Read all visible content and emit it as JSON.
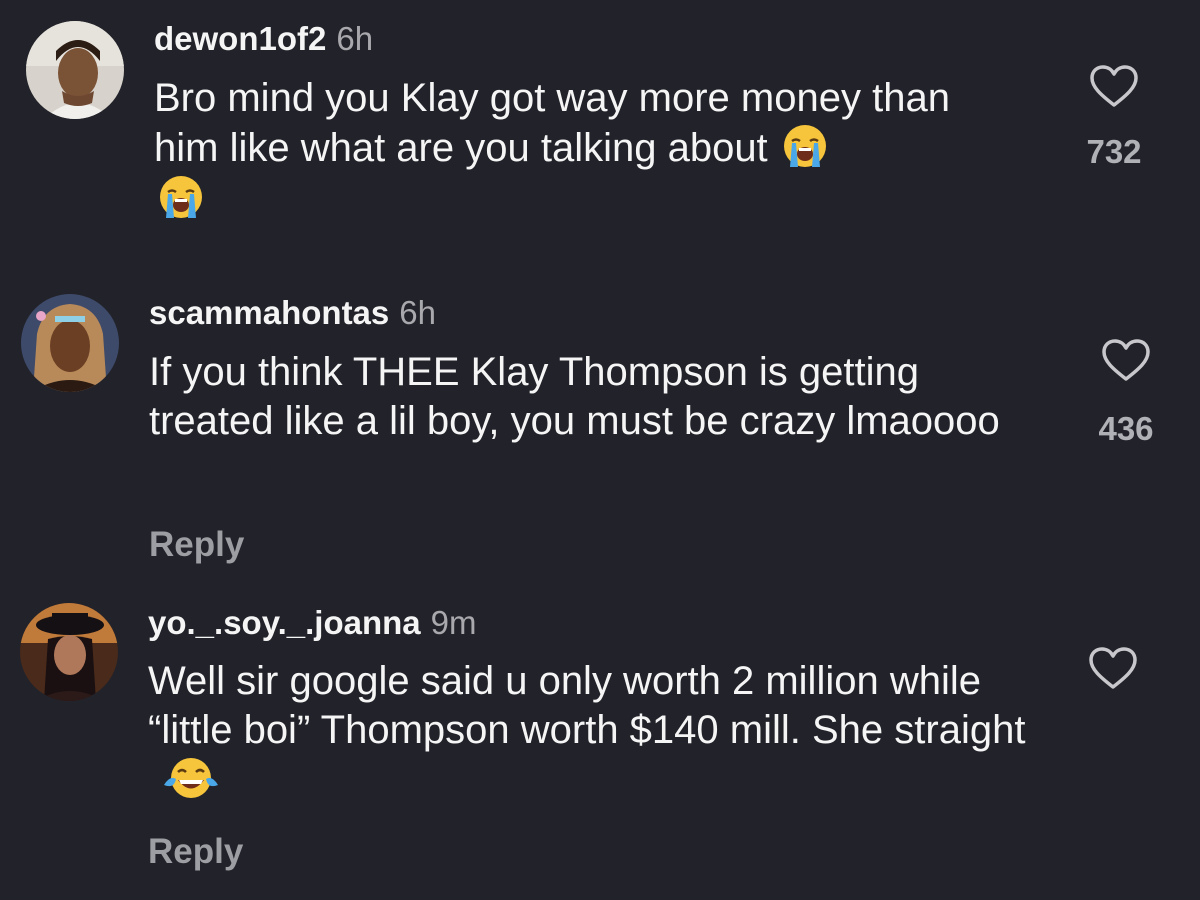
{
  "comments": [
    {
      "username": "dewon1of2",
      "time": "6h",
      "text": "Bro mind you Klay got way more money than him like what are you talking about",
      "emojis": [
        "loudly-crying-face",
        "loudly-crying-face"
      ],
      "likes": "732"
    },
    {
      "username": "scammahontas",
      "time": "6h",
      "text": "If you think THEE Klay Thompson is getting treated like a lil boy, you must be crazy lmaoooo",
      "likes": "436",
      "reply_label": "Reply"
    },
    {
      "username": "yo._.soy._.joanna",
      "time": "9m",
      "text": "Well sir google said u only worth 2 million while “little boi” Thompson worth $140 mill. She straight",
      "emojis": [
        "face-with-tears-of-joy"
      ],
      "reply_label": "Reply"
    }
  ],
  "colors": {
    "background": "#22232a",
    "text": "#f5f5f5",
    "muted": "#a8a8ad",
    "reply": "#9d9ea4",
    "heart": "#c8c8cc"
  }
}
